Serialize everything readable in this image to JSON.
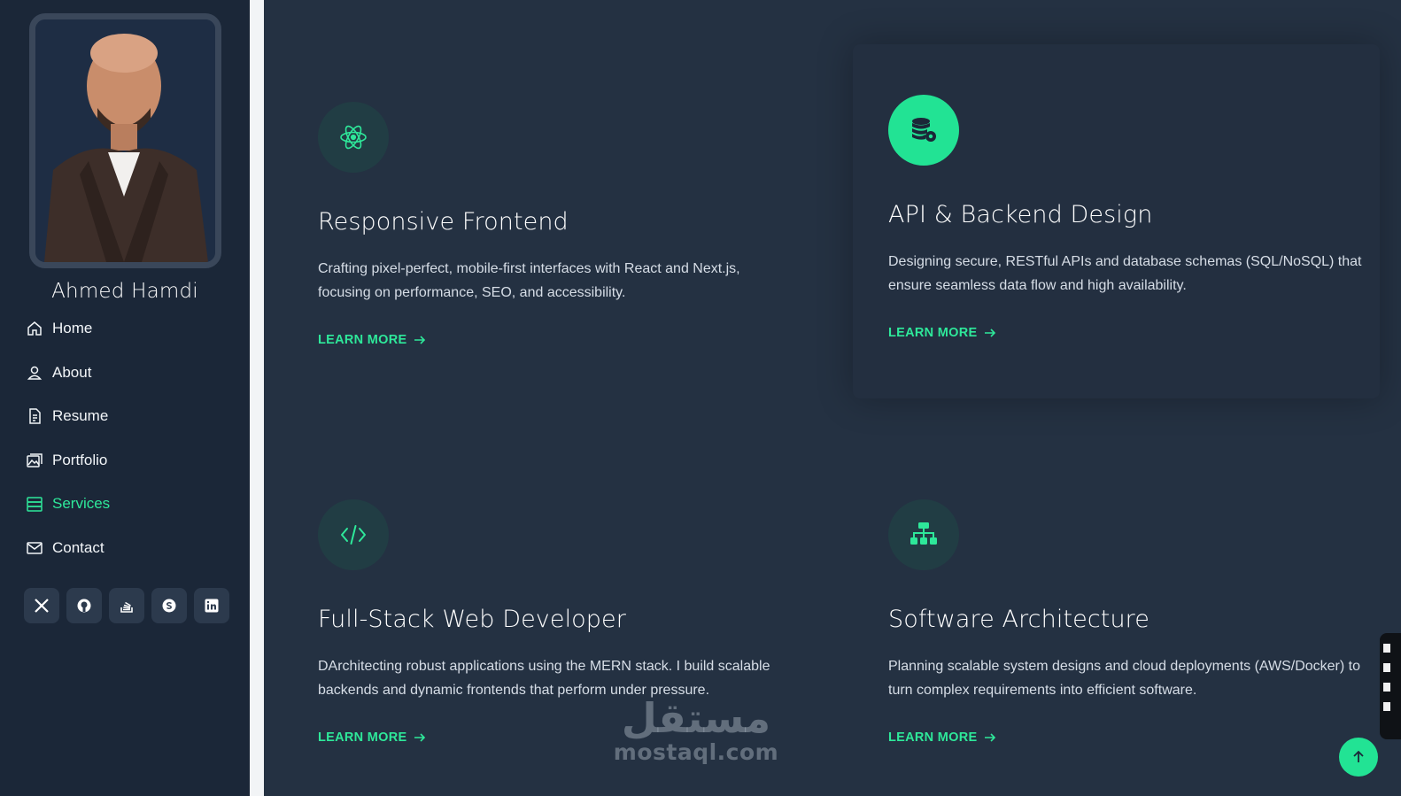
{
  "profile": {
    "name": "Ahmed Hamdi"
  },
  "nav": {
    "items": [
      {
        "label": "Home",
        "icon": "home-icon",
        "active": false
      },
      {
        "label": "About",
        "icon": "person-icon",
        "active": false
      },
      {
        "label": "Resume",
        "icon": "file-icon",
        "active": false
      },
      {
        "label": "Portfolio",
        "icon": "images-icon",
        "active": false
      },
      {
        "label": "Services",
        "icon": "hdd-stack-icon",
        "active": true
      },
      {
        "label": "Contact",
        "icon": "envelope-icon",
        "active": false
      }
    ]
  },
  "socials": [
    "x-twitter-icon",
    "github-icon",
    "stack-overflow-icon",
    "skype-icon",
    "linkedin-icon"
  ],
  "services": [
    {
      "title": "Responsive Frontend",
      "text": "Crafting pixel-perfect, mobile-first interfaces with React and Next.js, focusing on performance, SEO, and accessibility.",
      "link": "LEARN MORE",
      "icon": "react-atom-icon"
    },
    {
      "title": "API & Backend Design",
      "text": "Designing secure, RESTful APIs and database schemas (SQL/NoSQL) that ensure seamless data flow and high availability.",
      "link": "LEARN MORE",
      "icon": "database-gear-icon"
    },
    {
      "title": "Full-Stack Web Developer",
      "text": "DArchitecting robust applications using the MERN stack. I build scalable backends and dynamic frontends that perform under pressure.",
      "link": "LEARN MORE",
      "icon": "code-slash-icon"
    },
    {
      "title": "Software Architecture",
      "text": "Planning scalable system designs and cloud deployments (AWS/Docker) to turn complex requirements into efficient software.",
      "link": "LEARN MORE",
      "icon": "diagram-icon"
    }
  ],
  "watermark": {
    "arabic": "مستقل",
    "latin": "mostaql.com"
  },
  "colors": {
    "accent": "#2ee89a",
    "sidebar_bg": "#1b2738",
    "main_bg": "#243142"
  }
}
